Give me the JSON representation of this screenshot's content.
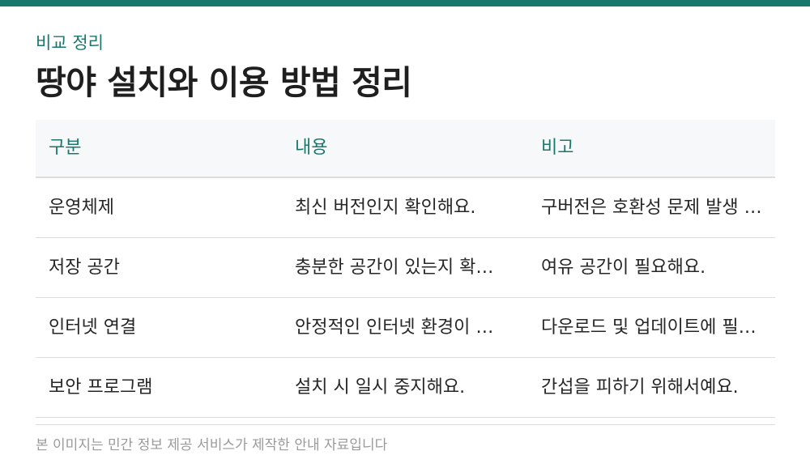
{
  "header": {
    "eyebrow": "비교 정리",
    "title": "땅야 설치와 이용 방법 정리"
  },
  "table": {
    "columns": [
      "구분",
      "내용",
      "비고"
    ],
    "rows": [
      [
        "운영체제",
        "최신 버전인지 확인해요.",
        "구버전은 호환성 문제 발생 가능해요."
      ],
      [
        "저장 공간",
        "충분한 공간이 있는지 확인해요.",
        "여유 공간이 필요해요."
      ],
      [
        "인터넷 연결",
        "안정적인 인터넷 환경이 필요해요.",
        "다운로드 및 업데이트에 필요해요."
      ],
      [
        "보안 프로그램",
        "설치 시 일시 중지해요.",
        "간섭을 피하기 위해서예요."
      ]
    ]
  },
  "footer": {
    "note": "본 이미지는 민간 정보 제공 서비스가 제작한 안내 자료입니다"
  },
  "colors": {
    "accent": "#19786b",
    "header_bg": "#f7f8f9",
    "divider": "#dcdcdc",
    "muted_text": "#9a9a9a"
  }
}
